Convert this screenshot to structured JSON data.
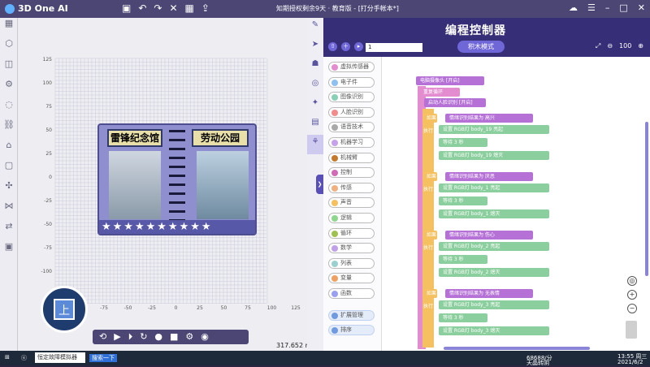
{
  "app": {
    "name": "3D One AI",
    "window_title": "知期授权剩余9天 · 教育版 - [打分手帐本*]"
  },
  "left_tools": [
    "grid-icon",
    "hexagon-icon",
    "cube-icon",
    "gear-icon",
    "tube-icon",
    "link-icon",
    "tree-icon",
    "frame-icon",
    "compass-icon",
    "network-icon",
    "swap-icon",
    "box-icon"
  ],
  "canvas": {
    "view_label": "上",
    "distance": "317.652 mm",
    "y_ticks": [
      "125",
      "100",
      "75",
      "50",
      "25",
      "0",
      "-25",
      "-50",
      "-75",
      "-100"
    ],
    "x_ticks": [
      "-75",
      "-50",
      "-25",
      "0",
      "25",
      "50",
      "75",
      "100",
      "125"
    ],
    "card_left_title": "雷锋纪念馆",
    "card_right_title": "劳动公园"
  },
  "panel": {
    "title": "编程控制器",
    "mode_button": "积木模式",
    "select_value": "1",
    "zoom": "100"
  },
  "categories": [
    {
      "label": "虚拟传感器",
      "color": "#e38cd0"
    },
    {
      "label": "电子件",
      "color": "#8fc1f0"
    },
    {
      "label": "图像识别",
      "color": "#8ad0b6"
    },
    {
      "label": "人脸识别",
      "color": "#f28b8b"
    },
    {
      "label": "语音技术",
      "color": "#a9a9a9"
    },
    {
      "label": "机器学习",
      "color": "#c6a3e8"
    },
    {
      "label": "机械臂",
      "color": "#c47a2c"
    },
    {
      "label": "控制",
      "color": "#d06bb5"
    },
    {
      "label": "传感",
      "color": "#f0b080"
    },
    {
      "label": "声音",
      "color": "#f5c060"
    },
    {
      "label": "逻辑",
      "color": "#8fd68f"
    },
    {
      "label": "循环",
      "color": "#a0c050"
    },
    {
      "label": "数学",
      "color": "#c0a0e8"
    },
    {
      "label": "列表",
      "color": "#9bd0d0"
    },
    {
      "label": "变量",
      "color": "#f0a060"
    },
    {
      "label": "函数",
      "color": "#9aa0f0"
    }
  ],
  "extra_buttons": [
    "扩展管理",
    "排序"
  ],
  "blocks": {
    "camera": "电脑摄像头 [开启]",
    "loop": "重复循环",
    "face": "启动人脸识别 [开启]",
    "groups": [
      {
        "cond": "如果",
        "label": "情绪识别结果为",
        "emotion": "高兴",
        "pin": "body_19",
        "on": "亮起",
        "off": "熄灭"
      },
      {
        "cond": "如果",
        "label": "情绪识别结果为",
        "emotion": "厌恶",
        "pin": "body_1",
        "on": "亮起",
        "off": "熄灭"
      },
      {
        "cond": "如果",
        "label": "情绪识别结果为",
        "emotion": "伤心",
        "pin": "body_2",
        "on": "亮起",
        "off": "熄灭"
      },
      {
        "cond": "如果",
        "label": "情绪识别结果为",
        "emotion": "无表情",
        "pin": "body_3",
        "on": "亮起",
        "off": "熄灭"
      }
    ],
    "exec": "执行",
    "set": "设置 RGB灯",
    "wait": "等待",
    "wait_val": "3",
    "sec": "秒"
  },
  "taskbar": {
    "search": "恒定故障模拟器",
    "search_btn": "搜索一下",
    "weather_temp": "68688/分",
    "weather_note": "天晶转阴",
    "time": "13:55 周三",
    "date": "2021/6/2"
  },
  "colors": {
    "accent": "#362f77",
    "block_purple": "#b571d6",
    "block_green": "#8ccf9e",
    "block_orange": "#f5c060",
    "block_pink": "#e38cd0"
  }
}
